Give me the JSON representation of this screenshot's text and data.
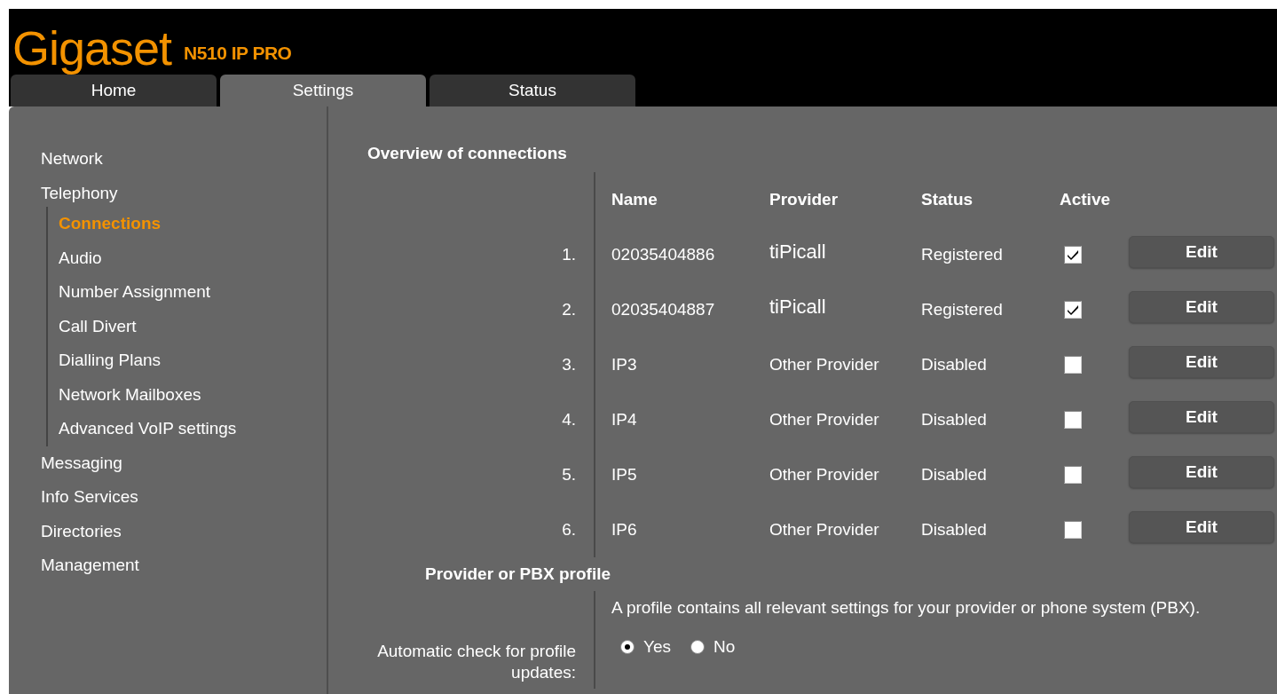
{
  "header": {
    "brand": "Gigaset",
    "model": "N510 IP PRO"
  },
  "tabs": [
    {
      "label": "Home",
      "selected": false
    },
    {
      "label": "Settings",
      "selected": true
    },
    {
      "label": "Status",
      "selected": false
    }
  ],
  "sidebar": {
    "items": [
      {
        "label": "Network",
        "selected": false
      },
      {
        "label": "Telephony",
        "selected": false,
        "children": [
          {
            "label": "Connections",
            "selected": true
          },
          {
            "label": "Audio",
            "selected": false
          },
          {
            "label": "Number Assignment",
            "selected": false
          },
          {
            "label": "Call Divert",
            "selected": false
          },
          {
            "label": "Dialling Plans",
            "selected": false
          },
          {
            "label": "Network Mailboxes",
            "selected": false
          },
          {
            "label": "Advanced VoIP settings",
            "selected": false
          }
        ]
      },
      {
        "label": "Messaging",
        "selected": false
      },
      {
        "label": "Info Services",
        "selected": false
      },
      {
        "label": "Directories",
        "selected": false
      },
      {
        "label": "Management",
        "selected": false
      }
    ]
  },
  "connections": {
    "title": "Overview of connections",
    "columns": [
      "Name",
      "Provider",
      "Status",
      "Active"
    ],
    "rows": [
      {
        "index": "1.",
        "name": "02035404886",
        "provider": "tiPicall",
        "kind": "custom",
        "status": "Registered",
        "active": true,
        "action": "Edit"
      },
      {
        "index": "2.",
        "name": "02035404887",
        "provider": "tiPicall",
        "kind": "custom",
        "status": "Registered",
        "active": true,
        "action": "Edit"
      },
      {
        "index": "3.",
        "name": "IP3",
        "provider": "Other Provider",
        "kind": "default",
        "status": "Disabled",
        "active": false,
        "action": "Edit"
      },
      {
        "index": "4.",
        "name": "IP4",
        "provider": "Other Provider",
        "kind": "default",
        "status": "Disabled",
        "active": false,
        "action": "Edit"
      },
      {
        "index": "5.",
        "name": "IP5",
        "provider": "Other Provider",
        "kind": "default",
        "status": "Disabled",
        "active": false,
        "action": "Edit"
      },
      {
        "index": "6.",
        "name": "IP6",
        "provider": "Other Provider",
        "kind": "default",
        "status": "Disabled",
        "active": false,
        "action": "Edit"
      }
    ]
  },
  "profile": {
    "title": "Provider or PBX profile",
    "description": "A profile contains all relevant settings for your provider or phone system (PBX).",
    "setting_label": "Automatic check for profile updates:",
    "options": [
      {
        "label": "Yes",
        "selected": true
      },
      {
        "label": "No",
        "selected": false
      }
    ]
  }
}
